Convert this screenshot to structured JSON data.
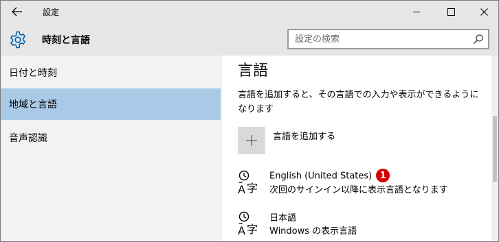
{
  "titlebar": {
    "title": "設定",
    "back_icon": "arrow-left-icon",
    "controls": [
      "minimize-icon",
      "maximize-icon",
      "close-icon"
    ]
  },
  "header": {
    "icon": "gear-icon",
    "title": "時刻と言語",
    "search_placeholder": "設定の検索",
    "search_icon": "search-icon"
  },
  "sidebar": {
    "items": [
      {
        "label": "日付と時刻",
        "active": false
      },
      {
        "label": "地域と言語",
        "active": true
      },
      {
        "label": "音声認識",
        "active": false
      }
    ]
  },
  "content": {
    "heading": "言語",
    "description": "言語を追加すると、その言語での入力や表示ができるようになります",
    "add_language": "言語を追加する",
    "languages": [
      {
        "name": "English (United States)",
        "status": "次回のサインイン以降に表示言語となります",
        "badge": "1"
      },
      {
        "name": "日本語",
        "status": "Windows の表示言語"
      }
    ]
  },
  "colors": {
    "titlebar_bg": "#e6e6e6",
    "sidebar_bg": "#f2f2f2",
    "selected_bg": "#a9cae6",
    "accent": "#0063b1",
    "badge": "#d40000"
  }
}
